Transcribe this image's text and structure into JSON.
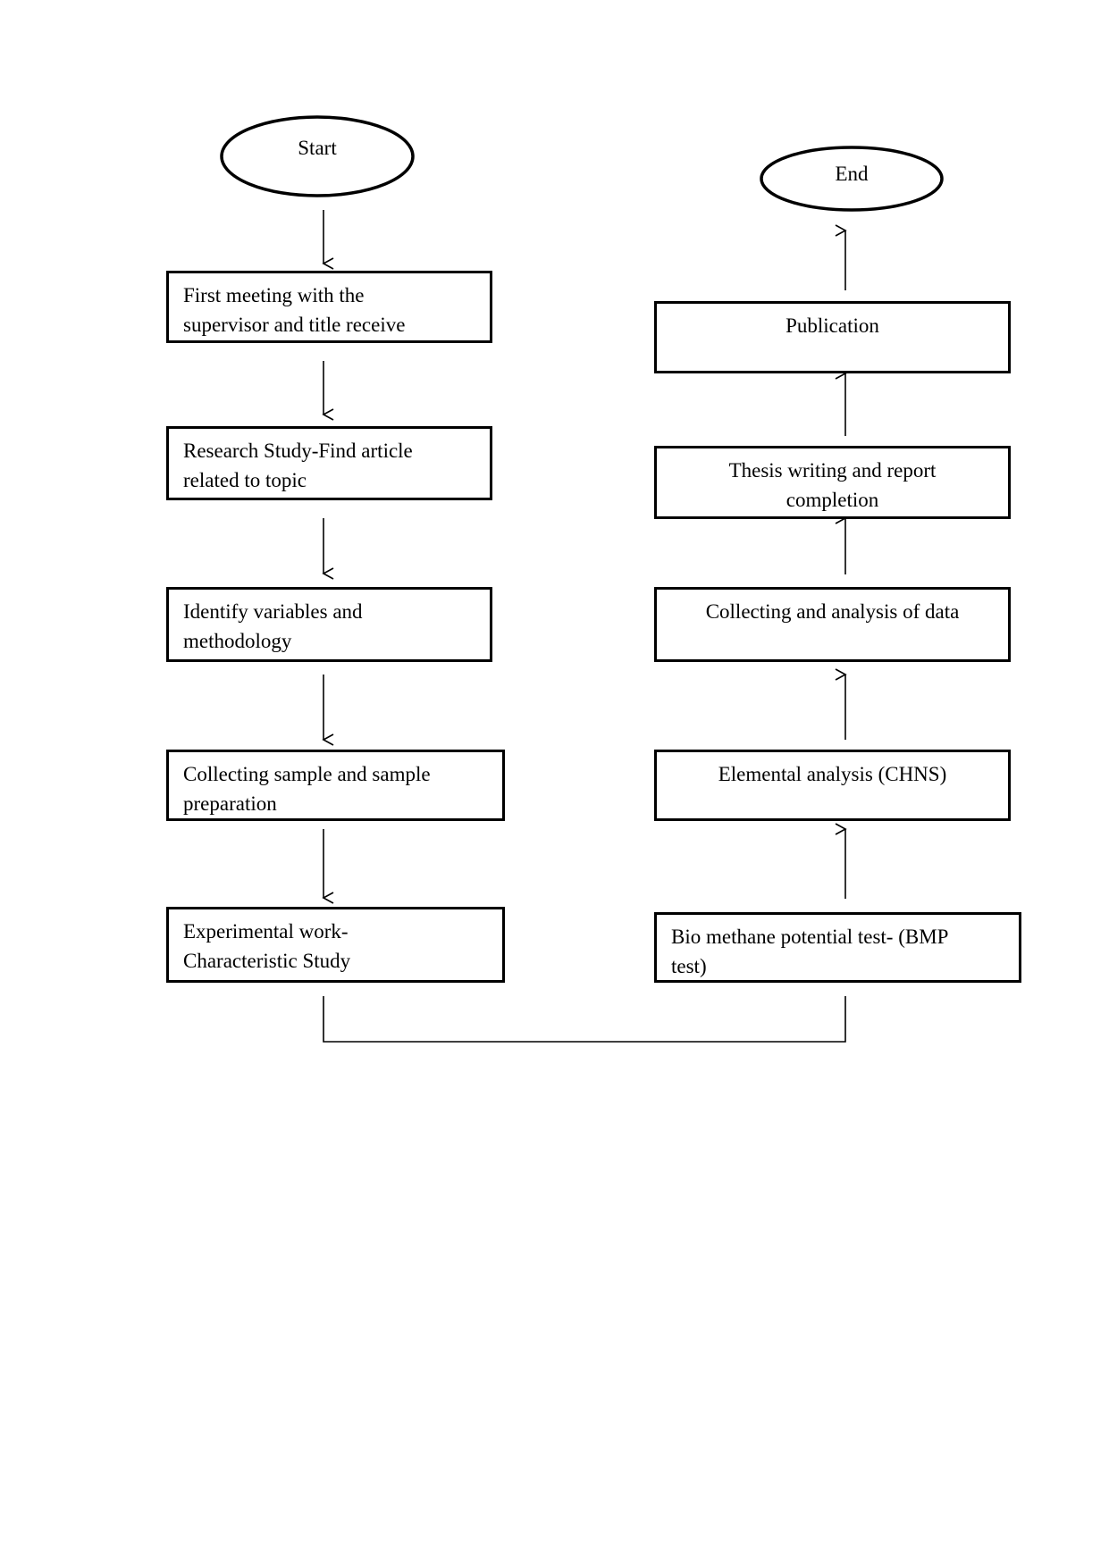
{
  "diagram": {
    "type": "flowchart",
    "start_label": "Start",
    "end_label": "End",
    "left_column": [
      {
        "label": "First meeting with the supervisor and title receive",
        "lines": [
          "First meeting with the",
          "supervisor and title receive"
        ]
      },
      {
        "label": "Research Study-Find article related to topic",
        "lines": [
          "Research Study-Find article",
          "related to topic"
        ]
      },
      {
        "label": "Identify variables and methodology",
        "lines": [
          "Identify variables and",
          "methodology"
        ]
      },
      {
        "label": "Collecting sample and sample preparation",
        "lines": [
          "Collecting sample and sample",
          "preparation"
        ]
      },
      {
        "label": "Experimental work-Characteristic Study",
        "lines": [
          "Experimental work-",
          "Characteristic Study"
        ]
      }
    ],
    "right_column": [
      {
        "label": "Bio methane potential test- (BMP test)",
        "lines": [
          "Bio methane potential test- (BMP",
          "test)"
        ]
      },
      {
        "label": "Elemental analysis (CHNS)",
        "lines": [
          "Elemental analysis (CHNS)"
        ]
      },
      {
        "label": "Collecting and analysis of data",
        "lines": [
          "Collecting and analysis of data"
        ]
      },
      {
        "label": "Thesis writing and report completion",
        "lines": [
          "Thesis writing and report",
          "completion"
        ]
      },
      {
        "label": "Publication",
        "lines": [
          "Publication"
        ]
      }
    ],
    "flow_order": [
      "Start",
      "First meeting with the supervisor and title receive",
      "Research Study-Find article related to topic",
      "Identify variables and methodology",
      "Collecting sample and sample preparation",
      "Experimental work-Characteristic Study",
      "Bio methane potential test- (BMP test)",
      "Elemental analysis (CHNS)",
      "Collecting and analysis of data",
      "Thesis writing and report completion",
      "Publication",
      "End"
    ]
  }
}
